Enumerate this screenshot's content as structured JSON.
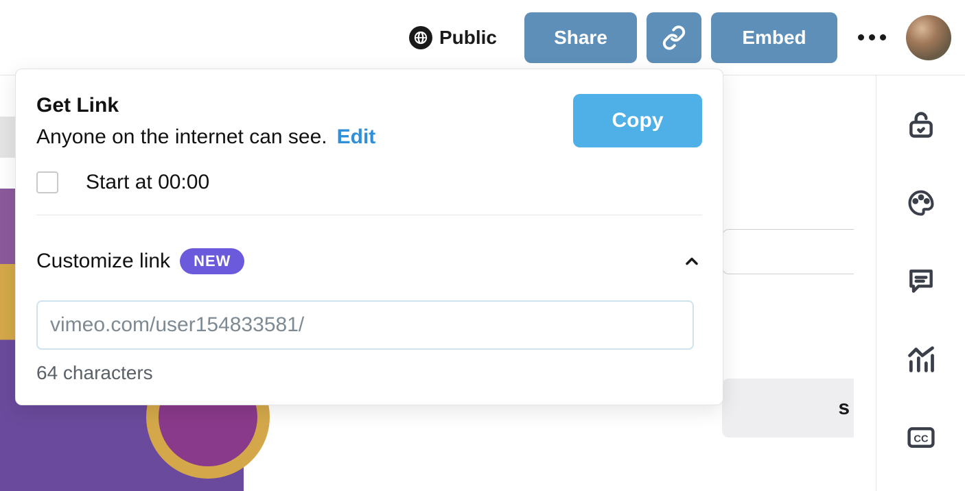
{
  "header": {
    "privacy_label": "Public",
    "share_label": "Share",
    "embed_label": "Embed"
  },
  "popover": {
    "title": "Get Link",
    "desc": "Anyone on the internet can see.",
    "edit_label": "Edit",
    "copy_label": "Copy",
    "startat_prefix": "Start at",
    "startat_time": "00:00",
    "customize_title": "Customize link",
    "badge": "NEW",
    "slug_placeholder": "vimeo.com/user154833581/",
    "char_count": "64 characters"
  },
  "bg": {
    "tab_tail": "s"
  }
}
